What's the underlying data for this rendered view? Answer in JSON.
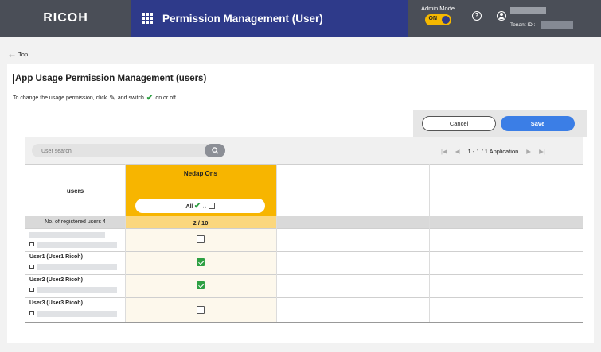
{
  "header": {
    "logo": "RICOH",
    "title": "Permission Management (User)",
    "admin_mode_label": "Admin Mode",
    "admin_toggle_label": "ON",
    "help_glyph": "?",
    "tenant_label": "Tenant ID :"
  },
  "nav": {
    "back_label": "Top"
  },
  "page": {
    "title": "App Usage Permission Management (users)",
    "instruction_part1": "To change the usage permission, click",
    "instruction_part2": "and switch",
    "instruction_part3": "on or off."
  },
  "actions": {
    "cancel_label": "Cancel",
    "save_label": "Save"
  },
  "search": {
    "placeholder": "User search"
  },
  "pager": {
    "text": "1 - 1 / 1 Application"
  },
  "table": {
    "users_header": "users",
    "app_name": "Nedap Ons",
    "all_toggle_label": "All",
    "all_toggle_arrow": "↔",
    "registered_label": "No. of registered users 4",
    "registered_count": "2 / 10",
    "rows": [
      {
        "name": "",
        "checked": false
      },
      {
        "name": "User1 (User1 Ricoh)",
        "checked": true
      },
      {
        "name": "User2 (User2 Ricoh)",
        "checked": true
      },
      {
        "name": "User3 (User3 Ricoh)",
        "checked": false
      }
    ]
  },
  "icons": {
    "apps": "grid-icon",
    "back": "arrow-left-icon",
    "help": "help-circle-icon",
    "user": "user-circle-icon",
    "pencil": "pencil-icon",
    "check": "checkmark-icon",
    "search": "search-icon",
    "mail": "mail-icon"
  },
  "colors": {
    "header_bg": "#4a4e57",
    "title_bg": "#2e3a8a",
    "accent_yellow": "#f7b500",
    "save_blue": "#3b7ee6",
    "check_green": "#2ea043"
  }
}
